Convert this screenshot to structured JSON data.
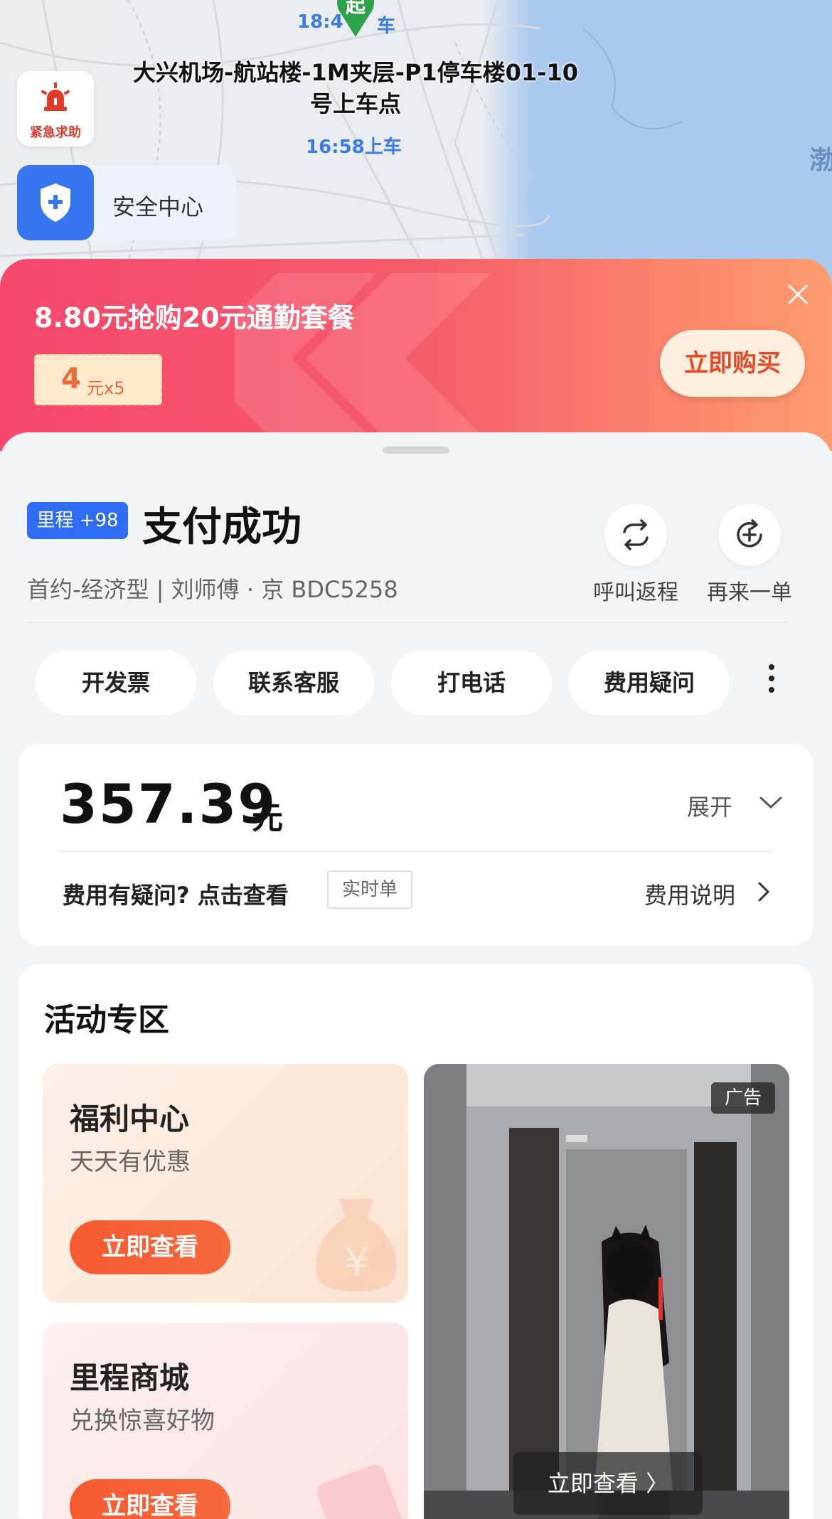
{
  "map": {
    "pickup_marker": "起",
    "top_time": "18:4",
    "top_time_suffix": "车",
    "place": "大兴机场-航站楼-1M夹层-P1停车楼01-10号上车点",
    "pickup_time": "16:58上车",
    "sea_label": "渤",
    "sos_label": "紧急求助",
    "sos_icon": "alarm-light-icon",
    "safety_label": "安全中心",
    "safety_icon": "shield-plus-icon"
  },
  "promo": {
    "title": "8.80元抢购20元通勤套餐",
    "coupon_value": "4",
    "coupon_unit": "元x5",
    "buy_label": "立即购买",
    "close_icon": "close-icon",
    "colors": {
      "start": "#f5476d",
      "end": "#fd9c6f"
    }
  },
  "order": {
    "mileage_badge": "里程 +98",
    "status": "支付成功",
    "trip_info": "首约-经济型 | 刘师傅 · 京 BDC5258",
    "return_trip_label": "呼叫返程",
    "reorder_label": "再来一单"
  },
  "actions": [
    {
      "label": "开发票"
    },
    {
      "label": "联系客服"
    },
    {
      "label": "打电话"
    },
    {
      "label": "费用疑问"
    }
  ],
  "fare": {
    "amount": "357.39",
    "unit": "元",
    "expand_label": "展开",
    "question": "费用有疑问? 点击查看",
    "realtime_tag": "实时单",
    "explain_label": "费用说明"
  },
  "activity": {
    "title": "活动专区",
    "tiles": [
      {
        "title": "福利中心",
        "subtitle": "天天有优惠",
        "button": "立即查看"
      },
      {
        "title": "里程商城",
        "subtitle": "兑换惊喜好物",
        "button": "立即查看"
      }
    ],
    "ad": {
      "tag": "广告",
      "button": "立即查看 〉"
    }
  },
  "colors": {
    "accent_blue": "#2f6cf5",
    "accent_orange": "#f65a30",
    "sea": "#a9c9ef"
  }
}
